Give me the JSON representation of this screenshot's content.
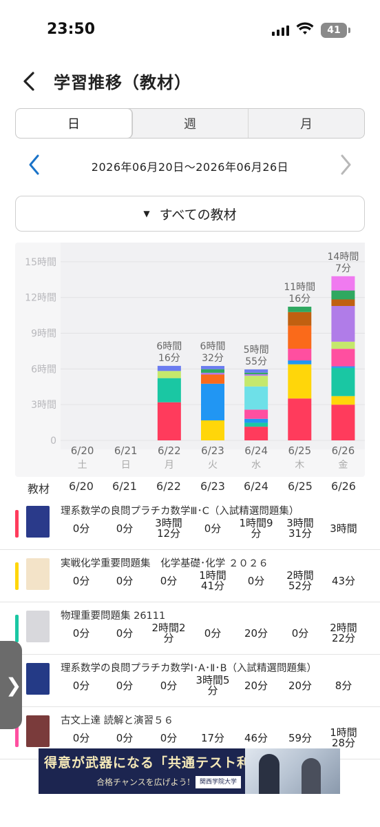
{
  "status": {
    "time": "23:50",
    "battery": "41"
  },
  "header": {
    "title": "学習推移（教材）"
  },
  "tabs": [
    {
      "label": "日",
      "active": true
    },
    {
      "label": "週",
      "active": false
    },
    {
      "label": "月",
      "active": false
    }
  ],
  "range": {
    "text": "2026年06月20日〜2026年06月26日"
  },
  "filter": {
    "label": "すべての教材"
  },
  "chart_data": {
    "type": "bar",
    "stacked": true,
    "categories": [
      "6/20",
      "6/21",
      "6/22",
      "6/23",
      "6/24",
      "6/25",
      "6/26"
    ],
    "weekdays": [
      "土",
      "日",
      "月",
      "火",
      "水",
      "木",
      "金"
    ],
    "yticks": [
      "0",
      "3時間",
      "6時間",
      "9時間",
      "12時間",
      "15時間"
    ],
    "ylim": [
      0,
      16.5
    ],
    "totals_labels": [
      [
        "",
        ""
      ],
      [
        "",
        ""
      ],
      [
        "6時間",
        "16分"
      ],
      [
        "6時間",
        "32分"
      ],
      [
        "5時間",
        "55分"
      ],
      [
        "11時間",
        "16分"
      ],
      [
        "14時間",
        "7分"
      ]
    ],
    "series": [
      {
        "color": "#ff3b5c",
        "values": [
          0,
          0,
          3.2,
          0,
          1.15,
          3.52,
          3.0
        ]
      },
      {
        "color": "#ffd60a",
        "values": [
          0,
          0,
          0,
          1.68,
          0,
          2.87,
          0.72
        ]
      },
      {
        "color": "#1ac7a3",
        "values": [
          0,
          0,
          2.03,
          0,
          0.33,
          0,
          2.37
        ]
      },
      {
        "color": "#2196f3",
        "values": [
          0,
          0,
          0,
          3.08,
          0.33,
          0.33,
          0.13
        ]
      },
      {
        "color": "#ff4fa0",
        "values": [
          0,
          0,
          0,
          0,
          0.77,
          0.98,
          1.47
        ]
      },
      {
        "color": "#6ee0e8",
        "values": [
          0,
          0,
          0,
          0,
          1.95,
          0,
          0
        ]
      },
      {
        "color": "#c5e86c",
        "values": [
          0,
          0,
          0.6,
          0,
          0.9,
          0,
          0.6
        ]
      },
      {
        "color": "#fa6a1a",
        "values": [
          0,
          0,
          0,
          0.77,
          0,
          1.93,
          0
        ]
      },
      {
        "color": "#b07ce8",
        "values": [
          0,
          0,
          0,
          0.15,
          0.13,
          0,
          3.0
        ]
      },
      {
        "color": "#c06010",
        "values": [
          0,
          0,
          0,
          0,
          0,
          1.15,
          0.55
        ]
      },
      {
        "color": "#2fa860",
        "values": [
          0,
          0,
          0,
          0.3,
          0.13,
          0.45,
          0.75
        ]
      },
      {
        "color": "#6b7cf0",
        "values": [
          0,
          0,
          0.43,
          0.27,
          0.27,
          0,
          0
        ]
      },
      {
        "color": "#f07af0",
        "values": [
          0,
          0,
          0,
          0,
          0,
          0,
          1.2
        ]
      }
    ]
  },
  "table": {
    "label": "教材",
    "dates": [
      "6/20",
      "6/21",
      "6/22",
      "6/23",
      "6/24",
      "6/25",
      "6/26"
    ],
    "rows": [
      {
        "name": "理系数学の良問プラチカ数学Ⅲ･C（入試精選問題集）",
        "color": "#ff3b5c",
        "thumb": "#2a3a8a",
        "cells": [
          [
            "0分"
          ],
          [
            "0分"
          ],
          [
            "3時間",
            "12分"
          ],
          [
            "0分"
          ],
          [
            "1時間9",
            "分"
          ],
          [
            "3時間",
            "31分"
          ],
          [
            "3時間"
          ]
        ]
      },
      {
        "name": "実戦化学重要問題集　化学基礎･化学 ２０２６",
        "color": "#ffd60a",
        "thumb": "#f3e3c8",
        "cells": [
          [
            "0分"
          ],
          [
            "0分"
          ],
          [
            "0分"
          ],
          [
            "1時間",
            "41分"
          ],
          [
            "0分"
          ],
          [
            "2時間",
            "52分"
          ],
          [
            "43分"
          ]
        ]
      },
      {
        "name": "物理重要問題集 26111",
        "color": "#1ac7a3",
        "thumb": "#d8d8dc",
        "cells": [
          [
            "0分"
          ],
          [
            "0分"
          ],
          [
            "2時間2",
            "分"
          ],
          [
            "0分"
          ],
          [
            "20分"
          ],
          [
            "0分"
          ],
          [
            "2時間",
            "22分"
          ]
        ]
      },
      {
        "name": "理系数学の良問プラチカ数学Ⅰ･A･Ⅱ･B（入試精選問題集）",
        "color": "#2196f3",
        "thumb": "#243a86",
        "cells": [
          [
            "0分"
          ],
          [
            "0分"
          ],
          [
            "0分"
          ],
          [
            "3時間5",
            "分"
          ],
          [
            "20分"
          ],
          [
            "20分"
          ],
          [
            "8分"
          ]
        ]
      },
      {
        "name": "古文上達 読解と演習５６",
        "color": "#ff4fa0",
        "thumb": "#7a3b3b",
        "cells": [
          [
            "0分"
          ],
          [
            "0分"
          ],
          [
            "0分"
          ],
          [
            "17分"
          ],
          [
            "46分"
          ],
          [
            "59分"
          ],
          [
            "1時間",
            "28分"
          ]
        ]
      }
    ]
  },
  "ad": {
    "main": "得意が武器になる「共通テスト利用」",
    "sub": "合格チャンスを広げよう!",
    "badge": "関西学院大学"
  }
}
